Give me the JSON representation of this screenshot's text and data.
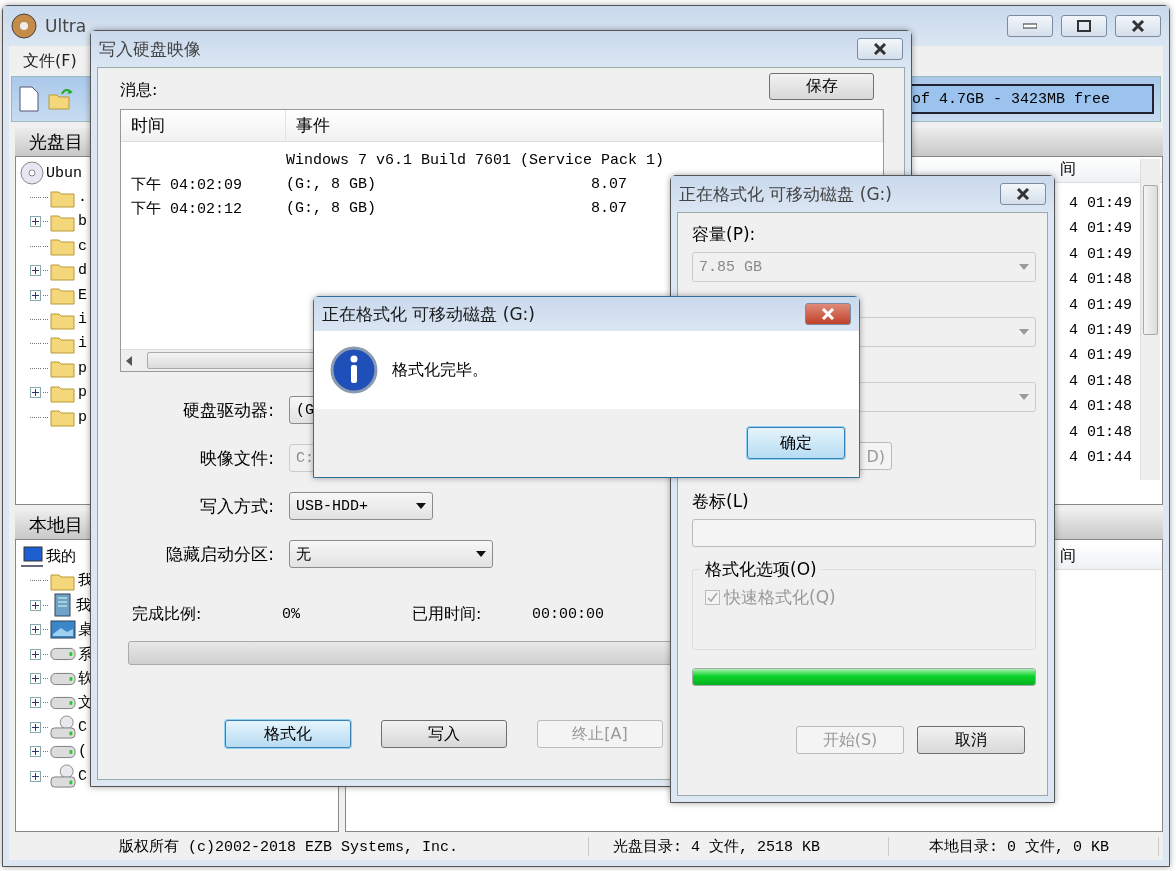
{
  "main_window": {
    "title": "Ultra",
    "menu": [
      "文件(F)"
    ],
    "capacity": "of 4.7GB - 3423MB free",
    "iso_panel": {
      "header": "光盘目",
      "tree": [
        {
          "label": "Ubun",
          "kind": "disc",
          "children": [
            {
              "label": ".",
              "kind": "folder",
              "expandable": false
            },
            {
              "label": "b",
              "kind": "folder",
              "expandable": true
            },
            {
              "label": "c",
              "kind": "folder",
              "expandable": false
            },
            {
              "label": "d",
              "kind": "folder",
              "expandable": true
            },
            {
              "label": "E",
              "kind": "folder",
              "expandable": true
            },
            {
              "label": "i",
              "kind": "folder",
              "expandable": false
            },
            {
              "label": "i",
              "kind": "folder",
              "expandable": false
            },
            {
              "label": "p",
              "kind": "folder",
              "expandable": false
            },
            {
              "label": "p",
              "kind": "folder",
              "expandable": true
            },
            {
              "label": "p",
              "kind": "folder",
              "expandable": false
            }
          ]
        }
      ]
    },
    "iso_list": {
      "column": "间",
      "rows": [
        "4 01:49",
        "4 01:49",
        "4 01:49",
        "4 01:48",
        "4 01:49",
        "4 01:49",
        "4 01:49",
        "4 01:48",
        "4 01:48",
        "4 01:48",
        "4 01:44"
      ]
    },
    "local_panel": {
      "header": "本地目",
      "tree": [
        {
          "label": "我的",
          "kind": "computer",
          "children": [
            {
              "label": "我",
              "kind": "folder",
              "expandable": false
            },
            {
              "label": "我",
              "kind": "docs",
              "expandable": true
            },
            {
              "label": "桌",
              "kind": "desktop",
              "expandable": true
            },
            {
              "label": "系",
              "kind": "drive",
              "expandable": true
            },
            {
              "label": "软",
              "kind": "drive",
              "expandable": true
            },
            {
              "label": "文",
              "kind": "drive",
              "expandable": true
            },
            {
              "label": "C",
              "kind": "cddrive",
              "expandable": true
            },
            {
              "label": "(",
              "kind": "drive",
              "expandable": true
            },
            {
              "label": "C",
              "kind": "cddrive",
              "expandable": true
            }
          ]
        }
      ]
    },
    "local_list": {
      "column": "间"
    },
    "status_bar": [
      "版权所有 (c)2002-2018 EZB Systems, Inc.",
      "光盘目录: 4 文件, 2518 KB",
      "本地目录: 0 文件, 0 KB"
    ]
  },
  "write_dialog": {
    "title": "写入硬盘映像",
    "message_label": "消息:",
    "save_button": "保存",
    "log": {
      "columns": [
        "时间",
        "事件"
      ],
      "rows": [
        {
          "event": "Windows 7 v6.1 Build 7601 (Service Pack 1)"
        },
        {
          "time": "下午 04:02:09",
          "event": "(G:, 8 GB)",
          "column_3": "8.07"
        },
        {
          "time": "下午 04:02:12",
          "event": "(G:, 8 GB)",
          "column_3": "8.07"
        }
      ]
    },
    "fields": [
      {
        "label": "硬盘驱动器:",
        "value": "(G",
        "kind": "combo",
        "disabled": false
      },
      {
        "label": "映像文件:",
        "value": "C:",
        "kind": "text",
        "disabled": true
      },
      {
        "label": "写入方式:",
        "value": "USB-HDD+",
        "kind": "combo",
        "disabled": false
      },
      {
        "label": "隐藏启动分区:",
        "value": "无",
        "kind": "combo",
        "disabled": false
      }
    ],
    "progress": {
      "done_label": "完成比例:",
      "done_value": "0%",
      "time_label": "已用时间:",
      "time_value": "00:00:00",
      "level": 0
    },
    "buttons": [
      {
        "label": "格式化",
        "default": true,
        "disabled": false
      },
      {
        "label": "写入",
        "default": false,
        "disabled": false
      },
      {
        "label": "终止[A]",
        "default": false,
        "disabled": true
      }
    ]
  },
  "format_dialog": {
    "title": "正在格式化 可移动磁盘 (G:)",
    "capacity_label": "容量(P):",
    "capacity_value": "7.85 GB",
    "restore_button": "D)",
    "volume_label": "卷标(L)",
    "options_label": "格式化选项(O)",
    "quick_format": {
      "label": "快速格式化(Q)",
      "checked": true,
      "disabled": true
    },
    "progress": {
      "level": 1
    },
    "buttons": [
      {
        "label": "开始(S)",
        "disabled": true
      },
      {
        "label": "取消",
        "disabled": false
      }
    ]
  },
  "message_box": {
    "title": "正在格式化 可移动磁盘 (G:)",
    "message": "格式化完毕。",
    "button": "确定"
  }
}
